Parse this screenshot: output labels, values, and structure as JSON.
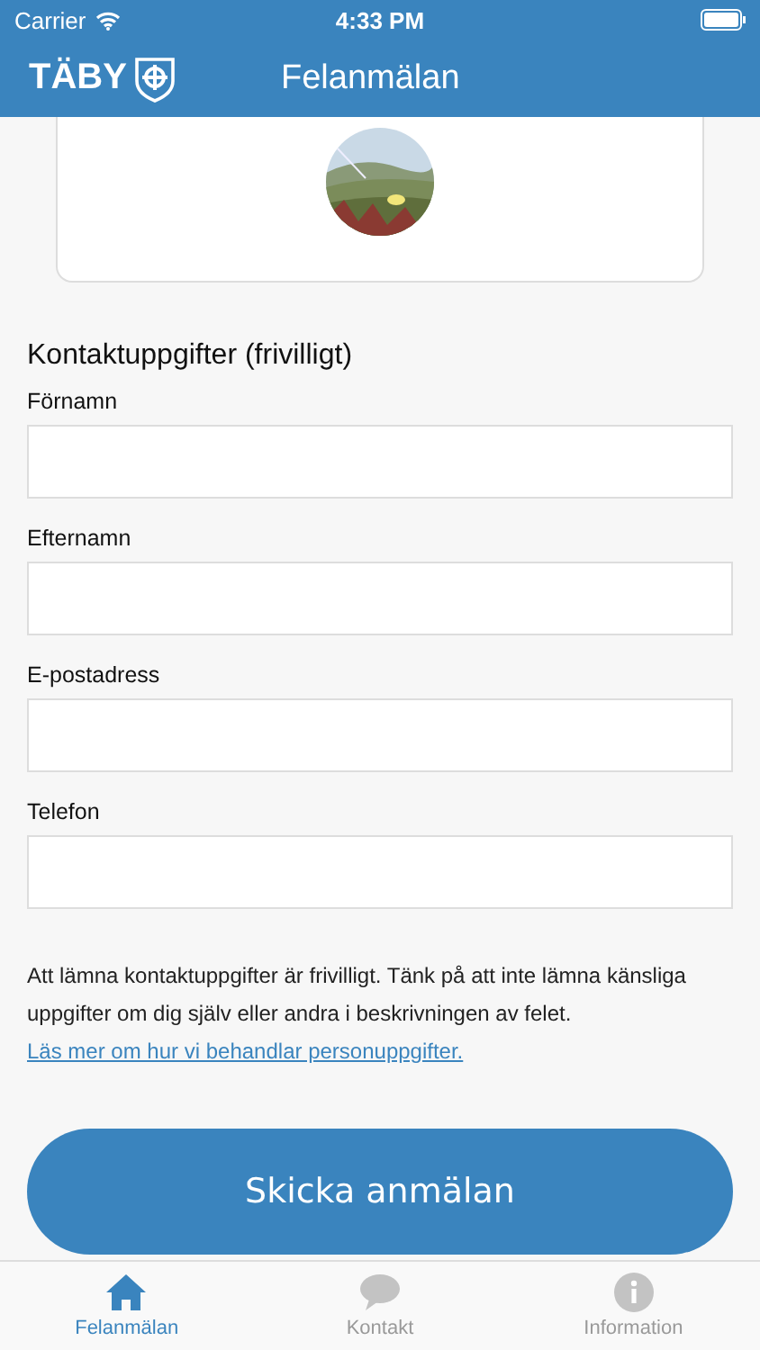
{
  "status_bar": {
    "carrier": "Carrier",
    "time": "4:33 PM"
  },
  "nav_bar": {
    "logo": "TÄBY",
    "title": "Felanmälan"
  },
  "contact_section": {
    "heading": "Kontaktuppgifter (frivilligt)",
    "fields": [
      {
        "label": "Förnamn"
      },
      {
        "label": "Efternamn"
      },
      {
        "label": "E-postadress"
      },
      {
        "label": "Telefon"
      }
    ],
    "notice": "Att lämna kontaktuppgifter är frivilligt. Tänk på att inte lämna känsliga uppgifter om dig själv eller andra i beskrivningen av felet.",
    "privacy_link": "Läs mer om hur vi behandlar personuppgifter."
  },
  "submit_button": "Skicka anmälan",
  "tab_bar": [
    {
      "label": "Felanmälan",
      "selected": true
    },
    {
      "label": "Kontakt",
      "selected": false
    },
    {
      "label": "Information",
      "selected": false
    }
  ]
}
